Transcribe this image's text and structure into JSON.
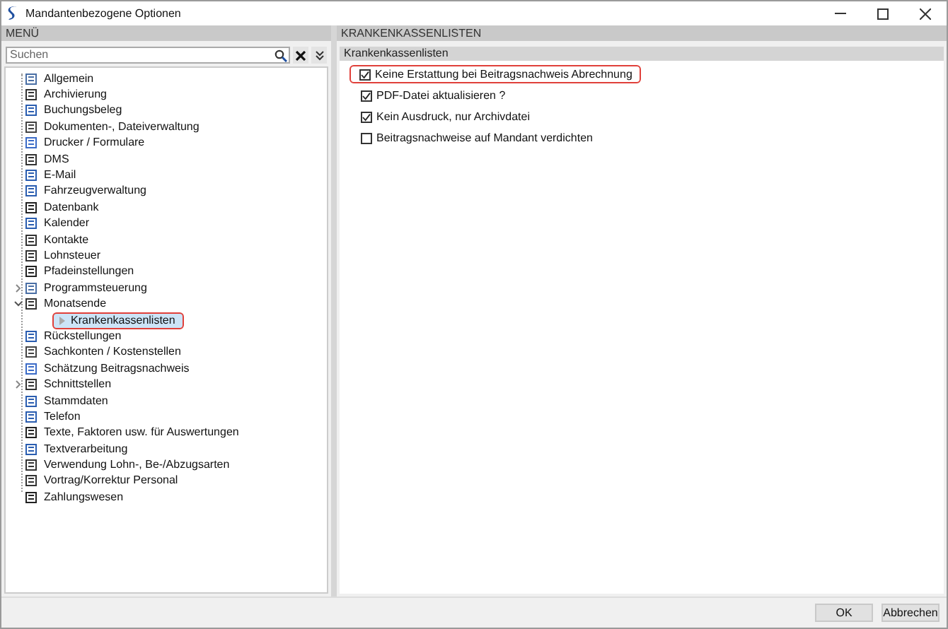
{
  "window": {
    "title": "Mandantenbezogene Optionen"
  },
  "menu": {
    "header": "MENÜ",
    "search": {
      "placeholder": "Suchen"
    },
    "items": [
      {
        "label": "Allgemein"
      },
      {
        "label": "Archivierung"
      },
      {
        "label": "Buchungsbeleg"
      },
      {
        "label": "Dokumenten-, Dateiverwaltung"
      },
      {
        "label": "Drucker / Formulare"
      },
      {
        "label": "DMS"
      },
      {
        "label": "E-Mail"
      },
      {
        "label": "Fahrzeugverwaltung"
      },
      {
        "label": "Datenbank"
      },
      {
        "label": "Kalender"
      },
      {
        "label": "Kontakte"
      },
      {
        "label": "Lohnsteuer"
      },
      {
        "label": "Pfadeinstellungen"
      },
      {
        "label": "Programmsteuerung",
        "expanded": false
      },
      {
        "label": "Monatsende",
        "expanded": true,
        "children": [
          {
            "label": "Krankenkassenlisten",
            "selected": true,
            "highlighted": true
          }
        ]
      },
      {
        "label": "Rückstellungen"
      },
      {
        "label": "Sachkonten / Kostenstellen"
      },
      {
        "label": "Schätzung Beitragsnachweis"
      },
      {
        "label": "Schnittstellen",
        "expanded": false
      },
      {
        "label": "Stammdaten"
      },
      {
        "label": "Telefon"
      },
      {
        "label": "Texte, Faktoren usw. für Auswertungen"
      },
      {
        "label": "Textverarbeitung"
      },
      {
        "label": "Verwendung Lohn-, Be-/Abzugsarten"
      },
      {
        "label": "Vortrag/Korrektur Personal"
      },
      {
        "label": "Zahlungswesen"
      }
    ]
  },
  "content": {
    "header": "KRANKENKASSENLISTEN",
    "section": "Krankenkassenlisten",
    "options": [
      {
        "label": "Keine Erstattung bei Beitragsnachweis Abrechnung",
        "checked": true,
        "highlighted": true
      },
      {
        "label": "PDF-Datei aktualisieren ?",
        "checked": true
      },
      {
        "label": "Kein Ausdruck, nur Archivdatei",
        "checked": true
      },
      {
        "label": "Beitragsnachweise auf Mandant verdichten",
        "checked": false
      }
    ]
  },
  "buttons": [
    {
      "label": "OK"
    },
    {
      "label": "Abbrechen"
    }
  ]
}
